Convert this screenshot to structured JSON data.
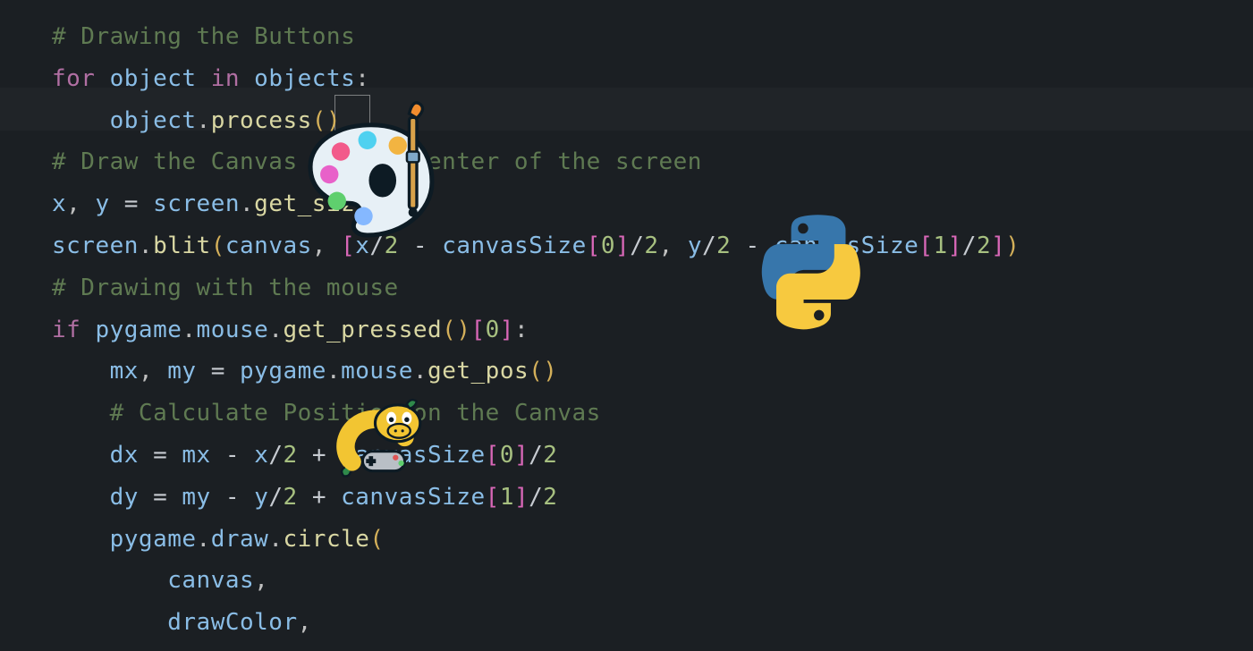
{
  "editor": {
    "comment_buttons": "# Drawing the Buttons",
    "kw_for": "for",
    "var_object": "object",
    "kw_in": "in",
    "var_objects": "objects",
    "punct_colon": ":",
    "call_object": "object",
    "dot": ".",
    "fn_process": "process",
    "paren_open": "(",
    "paren_close": ")",
    "comment_canvas_center": "# Draw the Canvas at the center of the screen",
    "var_x": "x",
    "comma": ",",
    "space": " ",
    "var_y": "y",
    "eq": "=",
    "var_screen": "screen",
    "fn_get_size": "get_size",
    "fn_blit": "blit",
    "var_canvas": "canvas",
    "var_canvasSize": "canvasSize",
    "bracket_open": "[",
    "bracket_close": "]",
    "num_0": "0",
    "num_1": "1",
    "num_2": "2",
    "slash": "/",
    "minus": "-",
    "plus": "+",
    "comment_mouse": "# Drawing with the mouse",
    "kw_if": "if",
    "var_pygame": "pygame",
    "var_mouse": "mouse",
    "fn_get_pressed": "get_pressed",
    "var_mx": "mx",
    "var_my": "my",
    "fn_get_pos": "get_pos",
    "comment_calc": "# Calculate Position on the Canvas",
    "var_dx": "dx",
    "var_dy": "dy",
    "var_draw": "draw",
    "fn_circle": "circle",
    "var_drawColor": "drawColor"
  },
  "assets": {
    "palette_name": "paint-palette-icon",
    "mascot_name": "pygame-snake-mascot-icon",
    "python_name": "python-logo-icon"
  },
  "colors": {
    "bg": "#1b1f23",
    "comment": "#5f7a52",
    "keyword": "#b16fa3",
    "variable": "#8abde6",
    "function": "#d9d7a3",
    "paren": "#d4b05a",
    "bracket": "#d867b7",
    "number": "#a7c080",
    "python_blue": "#3776ab",
    "python_yellow": "#f7c93f"
  }
}
